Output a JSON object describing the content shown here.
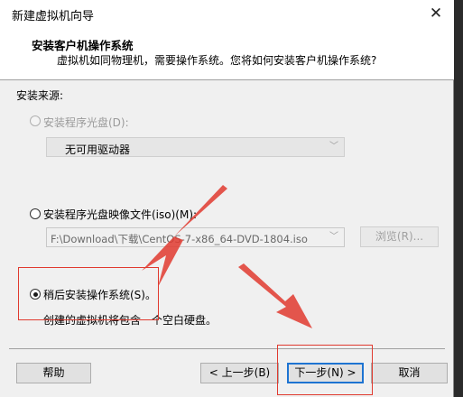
{
  "window": {
    "title": "新建虚拟机向导"
  },
  "header": {
    "title": "安装客户机操作系统",
    "subtitle": "虚拟机如同物理机，需要操作系统。您将如何安装客户机操作系统?"
  },
  "source": {
    "label": "安装来源:",
    "options": [
      {
        "label": "安装程序光盘(D):",
        "selected": false,
        "enabled": false
      },
      {
        "label": "安装程序光盘映像文件(iso)(M):",
        "selected": false,
        "enabled": true
      },
      {
        "label": "稍后安装操作系统(S)。",
        "selected": true,
        "enabled": true
      }
    ],
    "drive_value": "无可用驱动器",
    "iso_path": "F:\\Download\\下载\\CentOS-7-x86_64-DVD-1804.iso",
    "browse_label": "浏览(R)...",
    "later_desc": "创建的虚拟机将包含一个空白硬盘。"
  },
  "buttons": {
    "help": "帮助",
    "back": "< 上一步(B)",
    "next": "下一步(N) >",
    "cancel": "取消"
  },
  "icons": {
    "close": "close-icon",
    "dropdown": "chevron-down-icon"
  },
  "colors": {
    "annotation": "#e03a2f",
    "default_button_border": "#1e74d2"
  }
}
